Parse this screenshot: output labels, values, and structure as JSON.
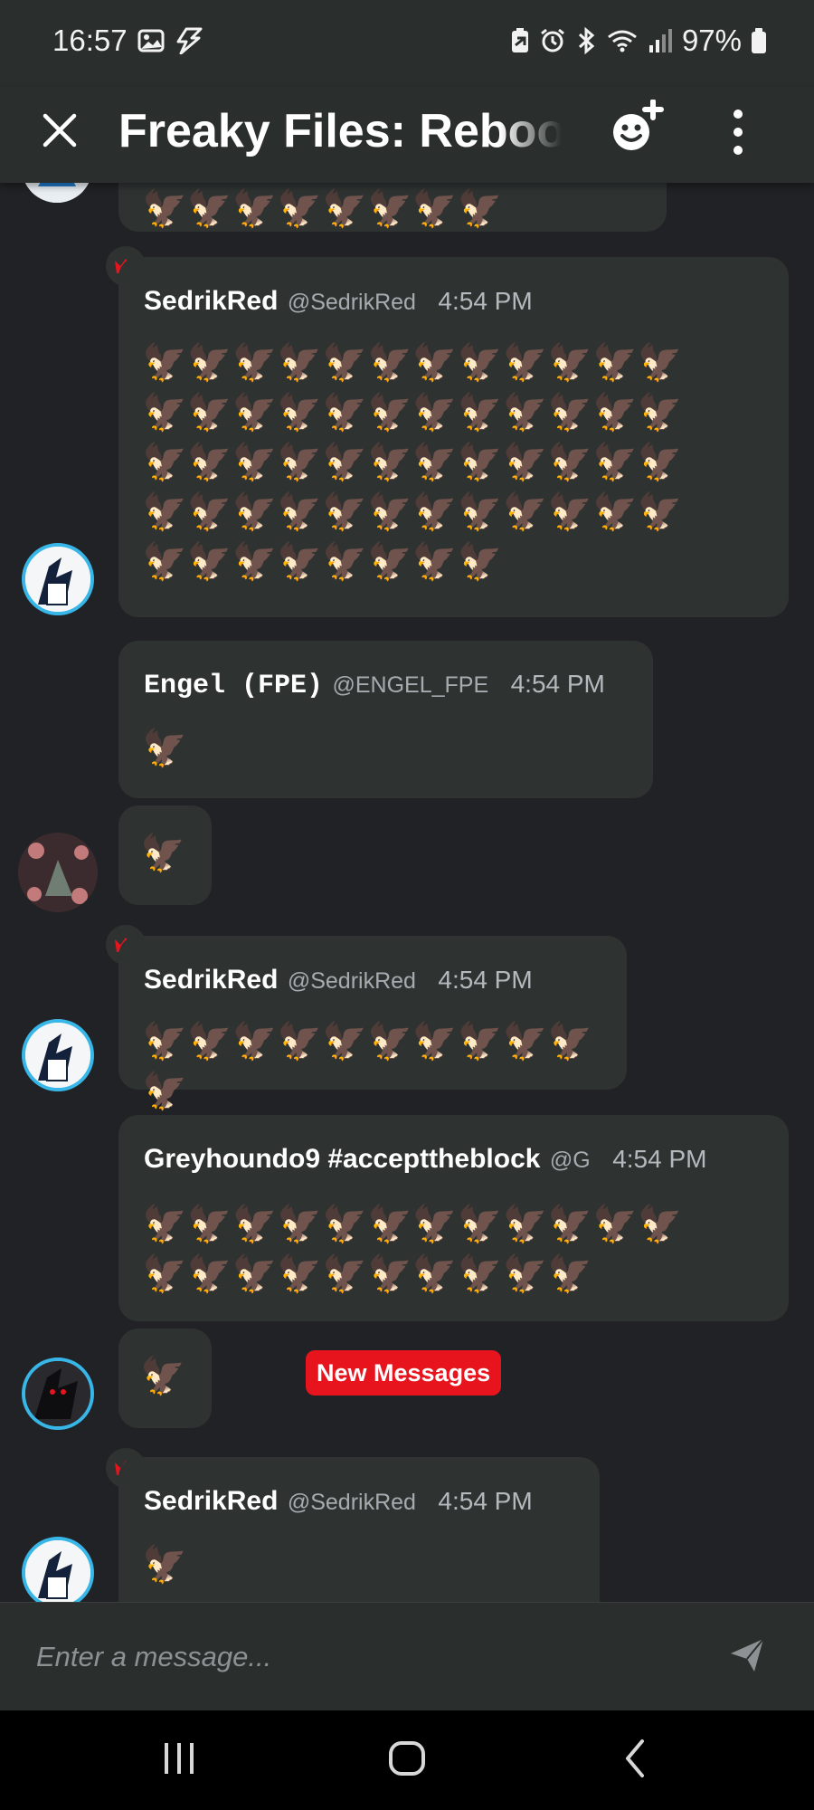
{
  "status_bar": {
    "time": "16:57",
    "battery_percent": "97%"
  },
  "header": {
    "title": "Freaky Files: Reboot"
  },
  "messages": [
    {
      "kind": "partial",
      "emojis": "🦅🦅🦅🦅🦅🦅🦅🦅"
    },
    {
      "kind": "full",
      "name": "SedrikRed",
      "handle": "@SedrikRed",
      "time": "4:54 PM",
      "emojis": "🦅🦅🦅🦅🦅🦅🦅🦅🦅🦅🦅🦅🦅🦅🦅🦅🦅🦅🦅🦅🦅🦅🦅🦅🦅🦅🦅🦅🦅🦅🦅🦅🦅🦅🦅🦅🦅🦅🦅🦅🦅🦅🦅🦅🦅🦅🦅🦅🦅🦅🦅🦅🦅🦅🦅🦅"
    },
    {
      "kind": "full",
      "name": "Engel (FPE)",
      "handle": "@ENGEL_FPE",
      "time": "4:54 PM",
      "emojis": "🦅"
    },
    {
      "kind": "continuation",
      "emojis": "🦅"
    },
    {
      "kind": "full",
      "name": "SedrikRed",
      "handle": "@SedrikRed",
      "time": "4:54 PM",
      "emojis": "🦅🦅🦅🦅🦅🦅🦅🦅🦅🦅🦅"
    },
    {
      "kind": "full",
      "name": "Greyhoundo9 #accepttheblock",
      "handle": "@G",
      "time": "4:54 PM",
      "emojis": "🦅🦅🦅🦅🦅🦅🦅🦅🦅🦅🦅🦅🦅🦅🦅🦅🦅🦅🦅🦅🦅🦅"
    },
    {
      "kind": "continuation",
      "emojis": "🦅"
    },
    {
      "kind": "full",
      "name": "SedrikRed",
      "handle": "@SedrikRed",
      "time": "4:54 PM",
      "emojis": "🦅"
    }
  ],
  "new_messages_label": "New Messages",
  "composer": {
    "placeholder": "Enter a message..."
  },
  "icons": {
    "close": "close-icon",
    "add_emoji": "add-reaction-icon",
    "more": "more-vertical-icon",
    "send": "send-icon",
    "crown": "crown-icon"
  },
  "colors": {
    "background": "#202225",
    "bubble": "#2e3332",
    "bar": "#2a2f2e",
    "new_messages_badge": "#e8141d",
    "crown": "#e8141d",
    "avatar_ring": "#38b6e8"
  }
}
